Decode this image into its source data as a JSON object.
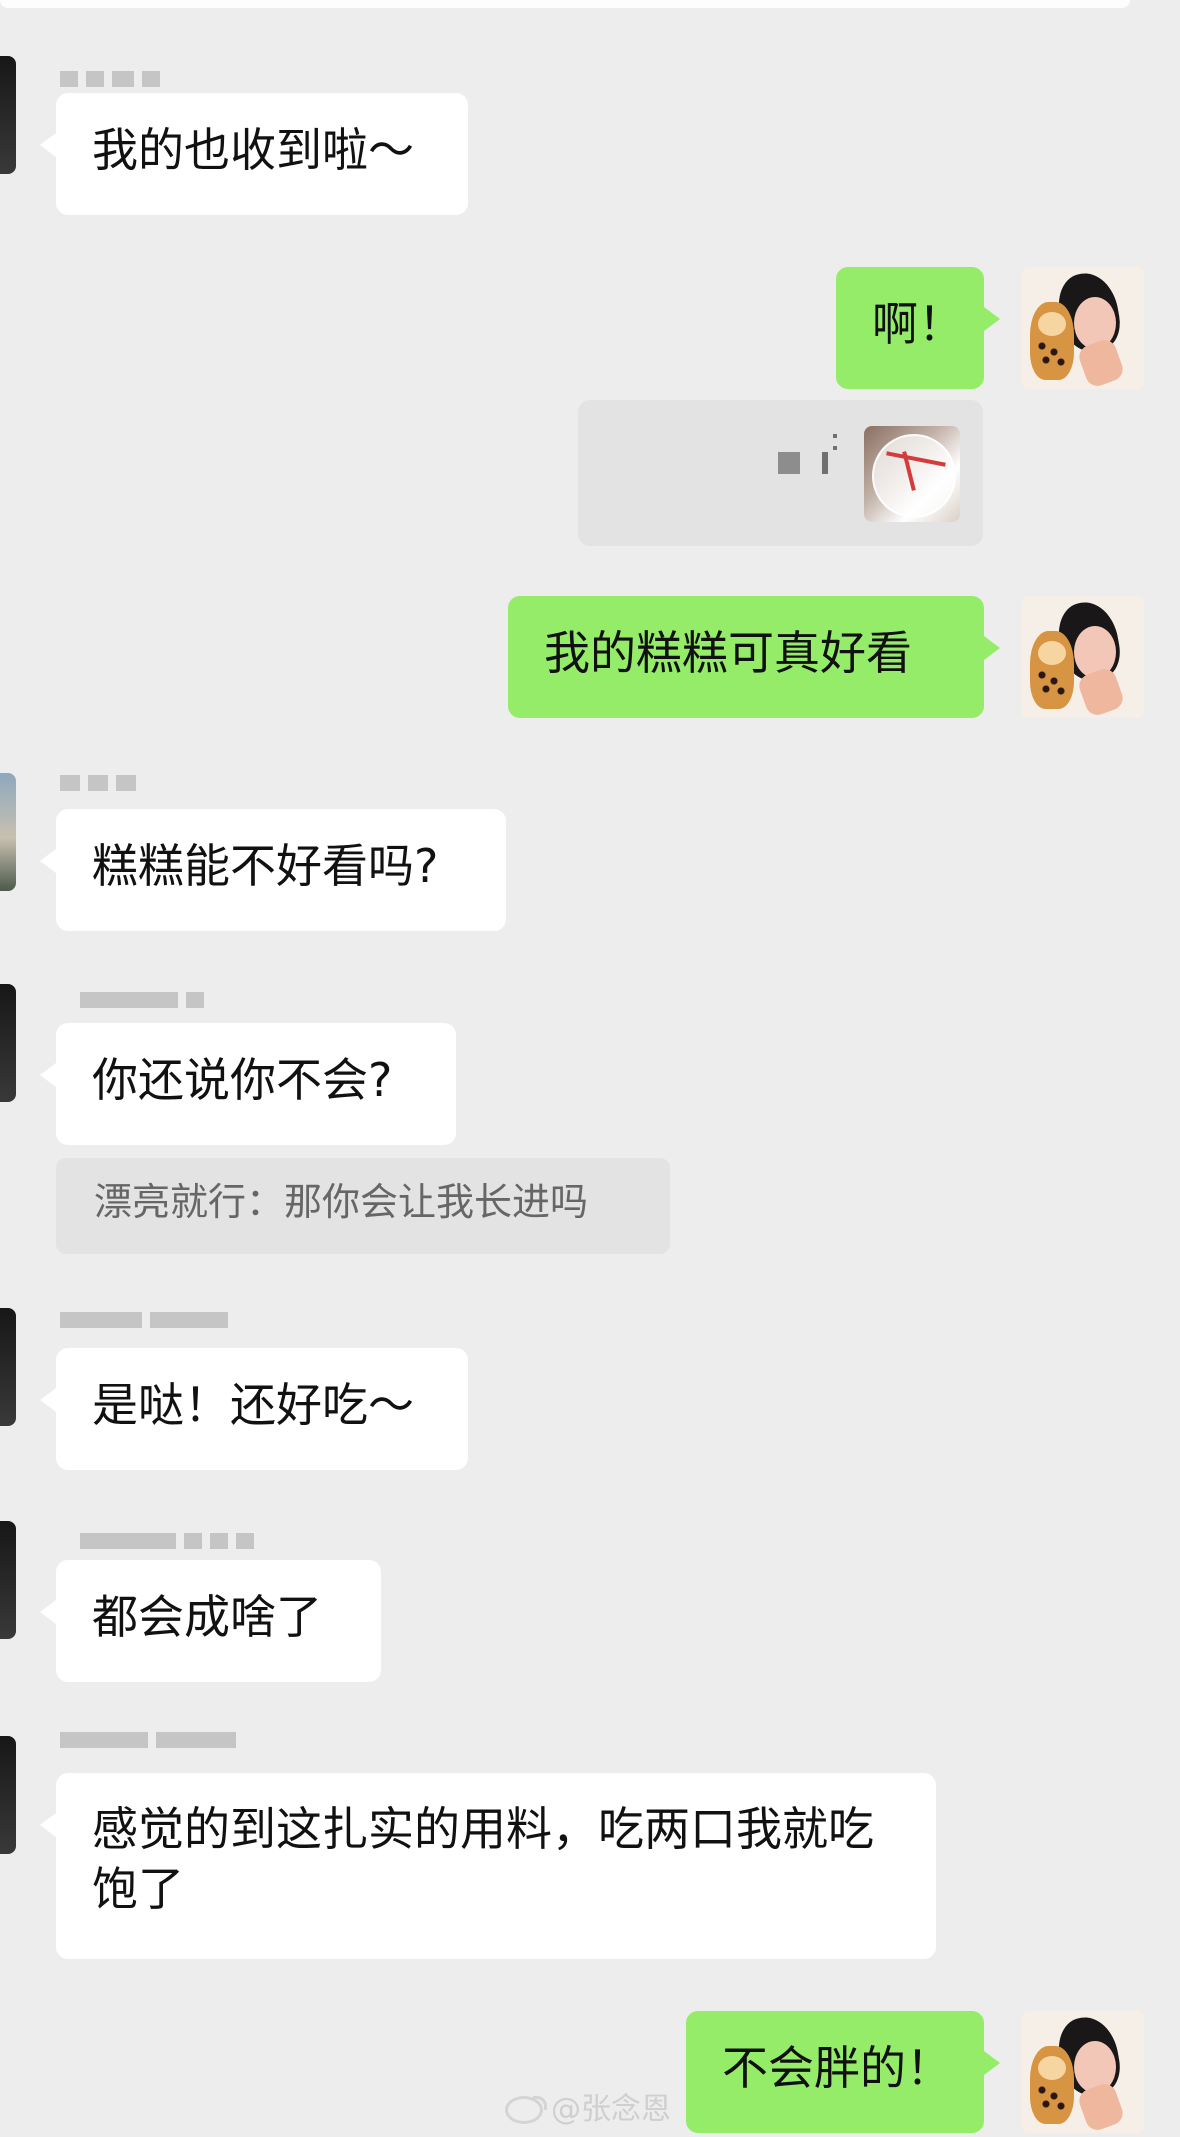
{
  "messages": [
    {
      "side": "left",
      "text": "我的也收到啦～"
    },
    {
      "side": "right",
      "text": "啊！"
    },
    {
      "side": "right",
      "text": "我的糕糕可真好看"
    },
    {
      "side": "left",
      "text": "糕糕能不好看吗?"
    },
    {
      "side": "left",
      "text": "你还说你不会?"
    },
    {
      "quote": "漂亮就行：那你会让我长进吗"
    },
    {
      "side": "left",
      "text": "是哒！还好吃～"
    },
    {
      "side": "left",
      "text": "都会成啥了"
    },
    {
      "side": "left",
      "text": "感觉的到这扎实的用料，吃两口我就吃饱了"
    },
    {
      "side": "right",
      "text": "不会胖的！"
    }
  ],
  "watermark": {
    "handle": "@张念恩",
    "logo": "weibo-logo-icon"
  },
  "colors": {
    "chat_background": "#ededed",
    "left_bubble": "#ffffff",
    "right_bubble": "#95ec69",
    "quote_background": "#e3e3e3"
  }
}
